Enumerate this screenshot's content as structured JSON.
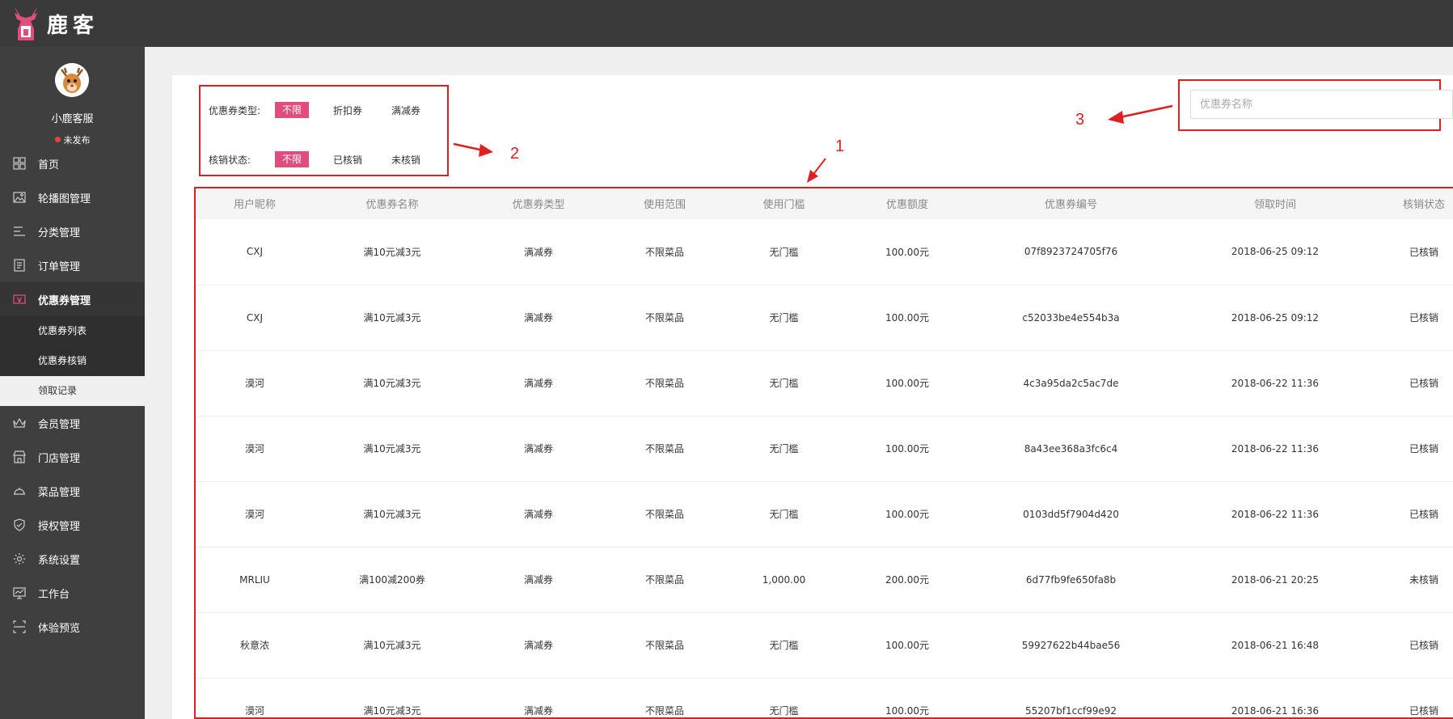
{
  "app": {
    "brand": "鹿客"
  },
  "profile": {
    "name": "小鹿客服",
    "status": "未发布"
  },
  "sidebar": {
    "items": [
      {
        "label": "首页",
        "icon": "grid-icon"
      },
      {
        "label": "轮播图管理",
        "icon": "image-icon"
      },
      {
        "label": "分类管理",
        "icon": "list-icon"
      },
      {
        "label": "订单管理",
        "icon": "order-icon"
      },
      {
        "label": "优惠券管理",
        "icon": "coupon-icon"
      },
      {
        "label": "会员管理",
        "icon": "crown-icon"
      },
      {
        "label": "门店管理",
        "icon": "store-icon"
      },
      {
        "label": "菜品管理",
        "icon": "dish-icon"
      },
      {
        "label": "授权管理",
        "icon": "shield-icon"
      },
      {
        "label": "系统设置",
        "icon": "gear-icon"
      },
      {
        "label": "工作台",
        "icon": "monitor-icon"
      },
      {
        "label": "体验预览",
        "icon": "preview-icon"
      }
    ],
    "coupon_sub": [
      "优惠券列表",
      "优惠券核销",
      "领取记录"
    ]
  },
  "filters": {
    "type": {
      "label": "优惠券类型:",
      "options": [
        "不限",
        "折扣券",
        "满减券"
      ]
    },
    "status": {
      "label": "核销状态:",
      "options": [
        "不限",
        "已核销",
        "未核销"
      ]
    }
  },
  "search": {
    "placeholder": "优惠券名称"
  },
  "annotations": [
    "1",
    "2",
    "3"
  ],
  "table": {
    "headers": [
      "用户昵称",
      "优惠券名称",
      "优惠券类型",
      "使用范围",
      "使用门槛",
      "优惠额度",
      "优惠券编号",
      "领取时间",
      "核销状态"
    ],
    "rows": [
      [
        "CXJ",
        "满10元减3元",
        "满减券",
        "不限菜品",
        "无门槛",
        "100.00元",
        "07f8923724705f76",
        "2018-06-25 09:12",
        "已核销"
      ],
      [
        "CXJ",
        "满10元减3元",
        "满减券",
        "不限菜品",
        "无门槛",
        "100.00元",
        "c52033be4e554b3a",
        "2018-06-25 09:12",
        "已核销"
      ],
      [
        "漠河",
        "满10元减3元",
        "满减券",
        "不限菜品",
        "无门槛",
        "100.00元",
        "4c3a95da2c5ac7de",
        "2018-06-22 11:36",
        "已核销"
      ],
      [
        "漠河",
        "满10元减3元",
        "满减券",
        "不限菜品",
        "无门槛",
        "100.00元",
        "8a43ee368a3fc6c4",
        "2018-06-22 11:36",
        "已核销"
      ],
      [
        "漠河",
        "满10元减3元",
        "满减券",
        "不限菜品",
        "无门槛",
        "100.00元",
        "0103dd5f7904d420",
        "2018-06-22 11:36",
        "已核销"
      ],
      [
        "MRLIU",
        "满100减200券",
        "满减券",
        "不限菜品",
        "1,000.00",
        "200.00元",
        "6d77fb9fe650fa8b",
        "2018-06-21 20:25",
        "未核销"
      ],
      [
        "秋意浓",
        "满10元减3元",
        "满减券",
        "不限菜品",
        "无门槛",
        "100.00元",
        "59927622b44bae56",
        "2018-06-21 16:48",
        "已核销"
      ],
      [
        "漠河",
        "满10元减3元",
        "满减券",
        "不限菜品",
        "无门槛",
        "100.00元",
        "55207bf1ccf99e92",
        "2018-06-21 16:36",
        "已核销"
      ]
    ]
  }
}
